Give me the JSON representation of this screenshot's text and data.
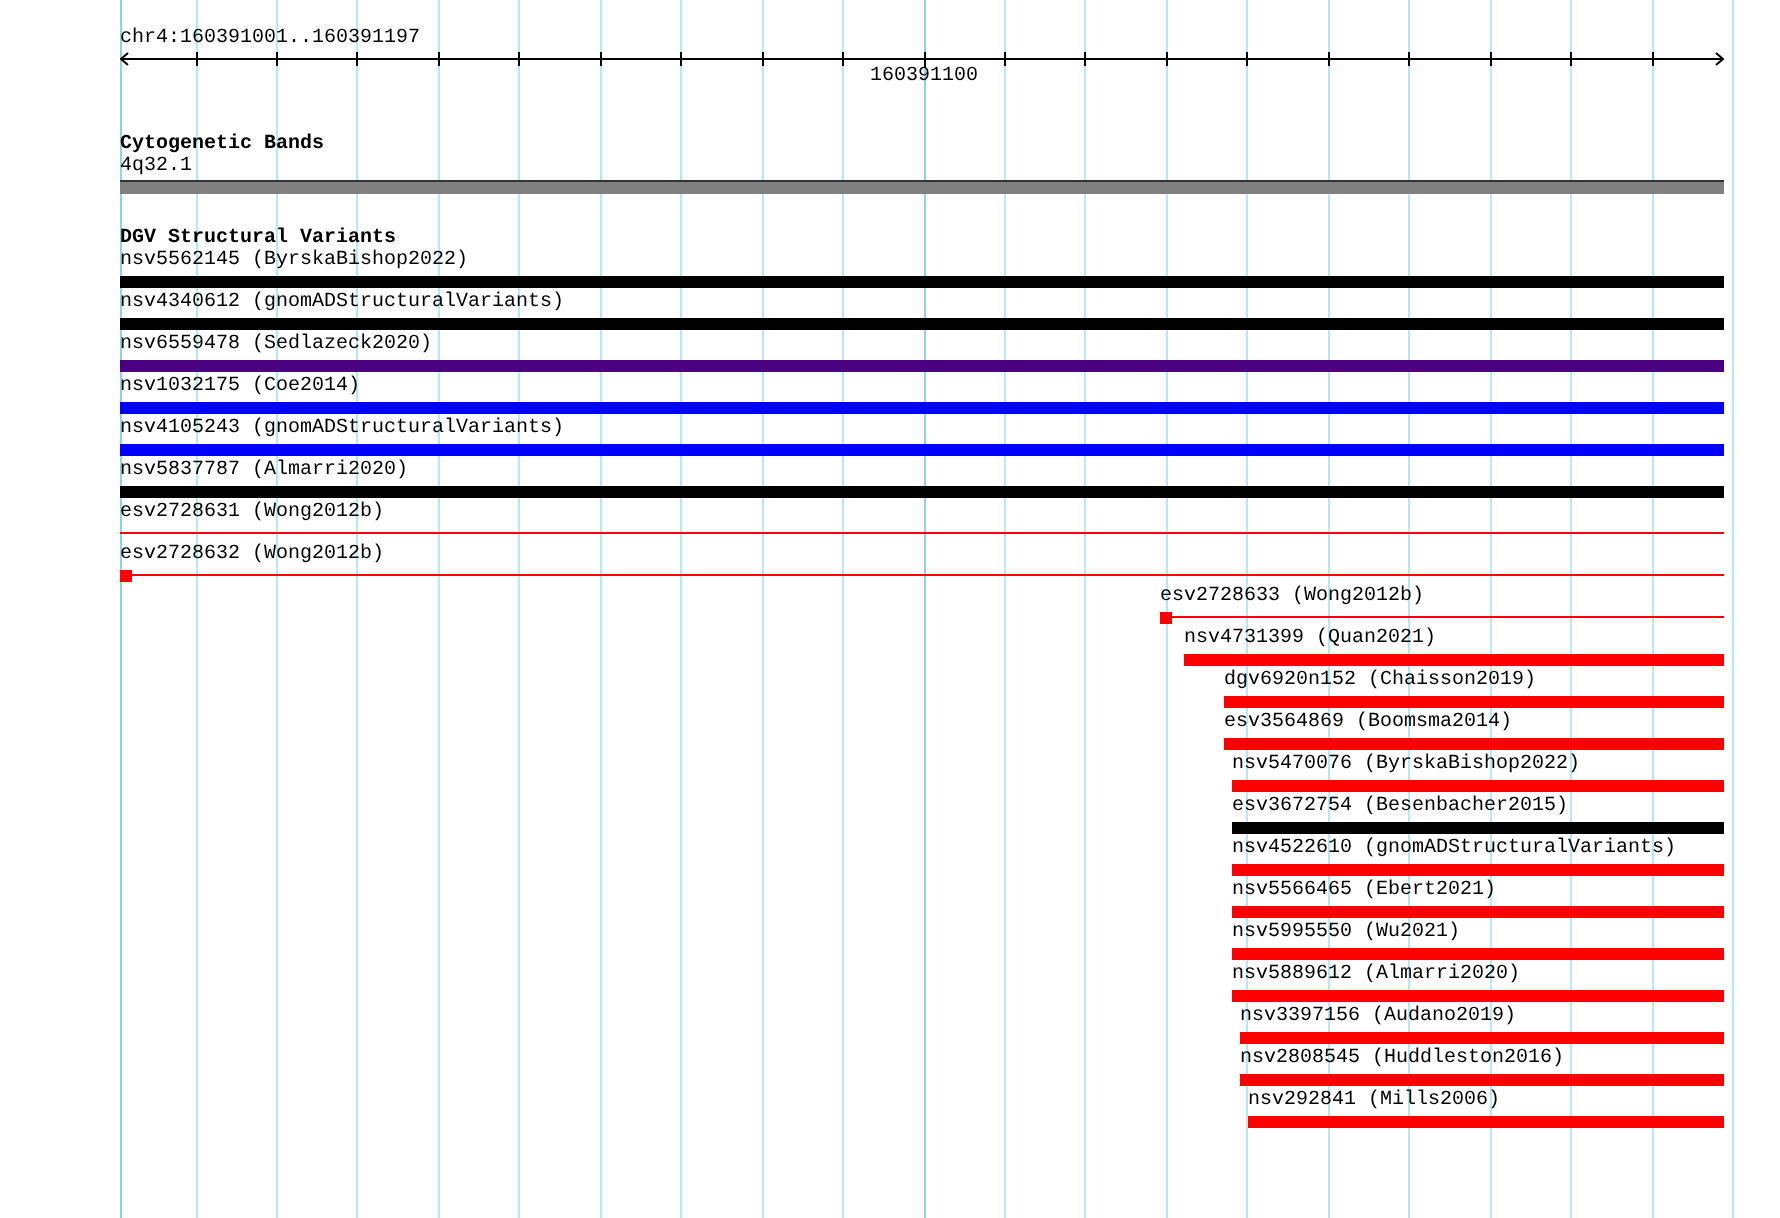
{
  "ruler": {
    "location": "chr4:160391001..160391197",
    "tick_label": "160391100"
  },
  "tracks": [
    {
      "kind": "bands",
      "title": "Cytogenetic Bands",
      "features": [
        {
          "label": "4q32.1",
          "kind": "band",
          "color": "#808080"
        }
      ]
    },
    {
      "kind": "variants",
      "title": "DGV Structural Variants",
      "features": [
        {
          "label": "nsv5562145 (ByrskaBishop2022)",
          "kind": "bar",
          "color": "#000000"
        },
        {
          "label": "nsv4340612 (gnomADStructuralVariants)",
          "kind": "bar",
          "color": "#000000"
        },
        {
          "label": "nsv6559478 (Sedlazeck2020)",
          "kind": "bar",
          "color": "#4b0082"
        },
        {
          "label": "nsv1032175 (Coe2014)",
          "kind": "bar",
          "color": "#0000ff"
        },
        {
          "label": "nsv4105243 (gnomADStructuralVariants)",
          "kind": "bar",
          "color": "#0000ff"
        },
        {
          "label": "nsv5837787 (Almarri2020)",
          "kind": "bar",
          "color": "#000000"
        },
        {
          "label": "esv2728631 (Wong2012b)",
          "kind": "line",
          "color": "#ff0000"
        },
        {
          "label": "esv2728632 (Wong2012b)",
          "kind": "line-with-start",
          "color": "#ff0000"
        },
        {
          "label": "esv2728633 (Wong2012b)",
          "kind": "line-with-start",
          "color": "#ff0000"
        },
        {
          "label": "nsv4731399 (Quan2021)",
          "kind": "bar",
          "color": "#ff0000"
        },
        {
          "label": "dgv6920n152 (Chaisson2019)",
          "kind": "bar",
          "color": "#ff0000"
        },
        {
          "label": "esv3564869 (Boomsma2014)",
          "kind": "bar",
          "color": "#ff0000"
        },
        {
          "label": "nsv5470076 (ByrskaBishop2022)",
          "kind": "bar",
          "color": "#ff0000"
        },
        {
          "label": "esv3672754 (Besenbacher2015)",
          "kind": "bar",
          "color": "#000000"
        },
        {
          "label": "nsv4522610 (gnomADStructuralVariants)",
          "kind": "bar",
          "color": "#ff0000"
        },
        {
          "label": "nsv5566465 (Ebert2021)",
          "kind": "bar",
          "color": "#ff0000"
        },
        {
          "label": "nsv5995550 (Wu2021)",
          "kind": "bar",
          "color": "#ff0000"
        },
        {
          "label": "nsv5889612 (Almarri2020)",
          "kind": "bar",
          "color": "#ff0000"
        },
        {
          "label": "nsv3397156 (Audano2019)",
          "kind": "bar",
          "color": "#ff0000"
        },
        {
          "label": "nsv2808545 (Huddleston2016)",
          "kind": "bar",
          "color": "#ff0000"
        },
        {
          "label": "nsv292841 (Mills2006)",
          "kind": "bar",
          "color": "#ff0000"
        }
      ]
    }
  ]
}
